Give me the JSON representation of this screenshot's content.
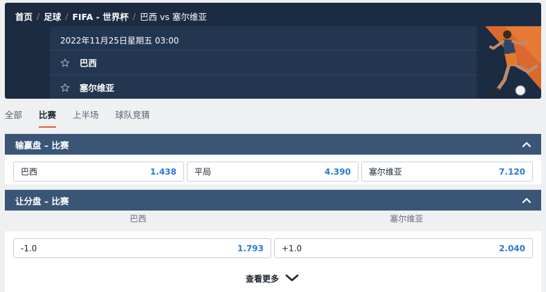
{
  "breadcrumb": [
    "首页",
    "足球",
    "FIFA - 世界杯",
    "巴西 vs 塞尔维亚"
  ],
  "match": {
    "date": "2022年11月25日星期五 03:00",
    "home": "巴西",
    "away": "塞尔维亚"
  },
  "tabs": [
    "全部",
    "比赛",
    "上半场",
    "球队竞猜"
  ],
  "active_tab": "比赛",
  "moneyline": {
    "title": "输赢盘 – 比赛",
    "options": [
      {
        "label": "巴西",
        "odds": "1.438"
      },
      {
        "label": "平局",
        "odds": "4.390"
      },
      {
        "label": "塞尔维亚",
        "odds": "7.120"
      }
    ]
  },
  "handicap": {
    "title": "让分盘 – 比赛",
    "home_header": "巴西",
    "away_header": "塞尔维亚",
    "options": [
      {
        "label": "-1.0",
        "odds": "1.793"
      },
      {
        "label": "+1.0",
        "odds": "2.040"
      }
    ]
  },
  "see_more": "查看更多",
  "colors": {
    "accent": "#e0603a",
    "odds": "#2a79d8",
    "panel": "#3a5576",
    "header": "#1b2b41"
  }
}
